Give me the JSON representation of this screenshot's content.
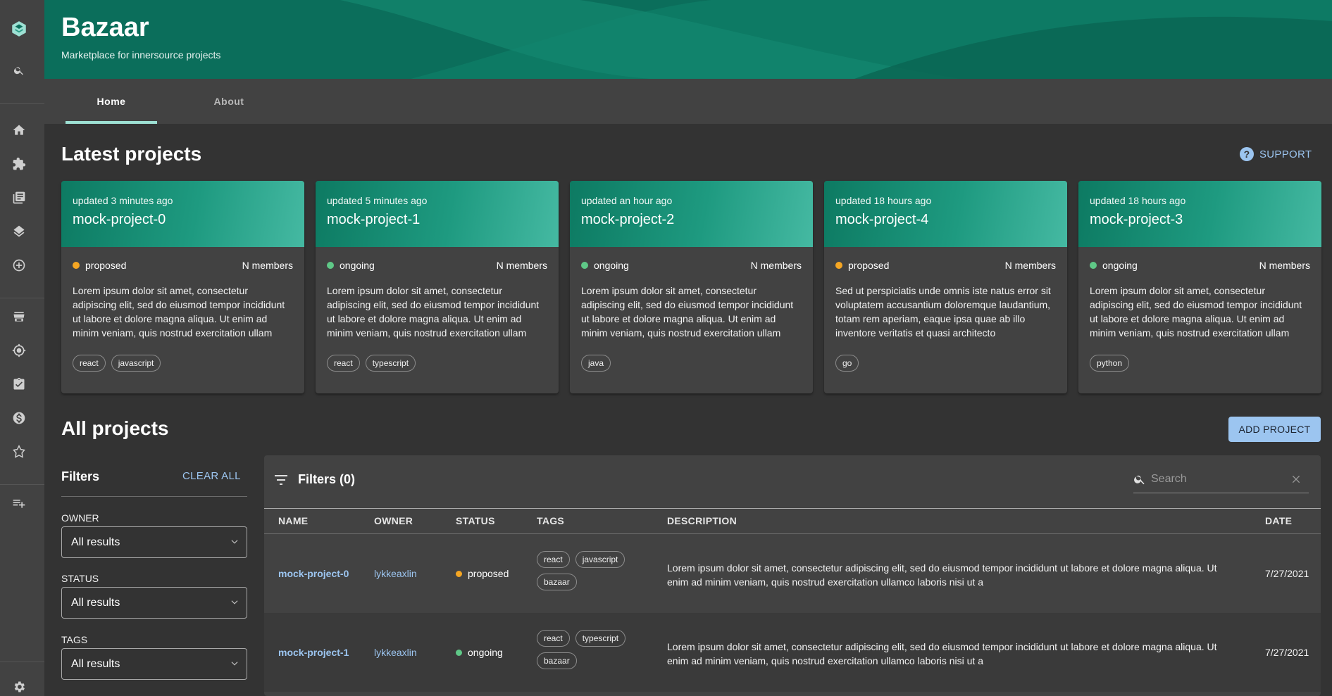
{
  "header": {
    "title": "Bazaar",
    "subtitle": "Marketplace for innersource projects"
  },
  "tabs": [
    {
      "label": "Home",
      "active": true
    },
    {
      "label": "About",
      "active": false
    }
  ],
  "sidebar": {
    "icons": [
      "logo-icon",
      "search-icon",
      "home-icon",
      "puzzle-icon",
      "library-icon",
      "layers-icon",
      "add-circle-icon",
      "storefront-icon",
      "radar-icon",
      "checklist-icon",
      "cost-icon",
      "graph-icon",
      "playlist-add-icon",
      "settings-icon"
    ]
  },
  "latest": {
    "heading": "Latest projects",
    "support_label": "SUPPORT",
    "cards": [
      {
        "updated": "updated 3 minutes ago",
        "name": "mock-project-0",
        "status": "proposed",
        "members": "N members",
        "description": "Lorem ipsum dolor sit amet, consectetur adipiscing elit, sed do eiusmod tempor incididunt ut labore et dolore magna aliqua. Ut enim ad minim veniam, quis nostrud exercitation ullam",
        "tags": [
          "react",
          "javascript"
        ]
      },
      {
        "updated": "updated 5 minutes ago",
        "name": "mock-project-1",
        "status": "ongoing",
        "members": "N members",
        "description": "Lorem ipsum dolor sit amet, consectetur adipiscing elit, sed do eiusmod tempor incididunt ut labore et dolore magna aliqua. Ut enim ad minim veniam, quis nostrud exercitation ullam",
        "tags": [
          "react",
          "typescript"
        ]
      },
      {
        "updated": "updated an hour ago",
        "name": "mock-project-2",
        "status": "ongoing",
        "members": "N members",
        "description": "Lorem ipsum dolor sit amet, consectetur adipiscing elit, sed do eiusmod tempor incididunt ut labore et dolore magna aliqua. Ut enim ad minim veniam, quis nostrud exercitation ullam",
        "tags": [
          "java"
        ]
      },
      {
        "updated": "updated 18 hours ago",
        "name": "mock-project-4",
        "status": "proposed",
        "members": "N members",
        "description": "Sed ut perspiciatis unde omnis iste natus error sit voluptatem accusantium doloremque laudantium, totam rem aperiam, eaque ipsa quae ab illo inventore veritatis et quasi architecto",
        "tags": [
          "go"
        ]
      },
      {
        "updated": "updated 18 hours ago",
        "name": "mock-project-3",
        "status": "ongoing",
        "members": "N members",
        "description": "Lorem ipsum dolor sit amet, consectetur adipiscing elit, sed do eiusmod tempor incididunt ut labore et dolore magna aliqua. Ut enim ad minim veniam, quis nostrud exercitation ullam",
        "tags": [
          "python"
        ]
      }
    ]
  },
  "all": {
    "heading": "All projects",
    "add_label": "ADD PROJECT",
    "filters": {
      "title": "Filters",
      "clear_label": "CLEAR ALL",
      "owner_label": "OWNER",
      "owner_value": "All results",
      "status_label": "STATUS",
      "status_value": "All results",
      "tags_label": "TAGS",
      "tags_value": "All results"
    },
    "table": {
      "filters_label": "Filters (0)",
      "search_placeholder": "Search",
      "columns": [
        "NAME",
        "OWNER",
        "STATUS",
        "TAGS",
        "DESCRIPTION",
        "DATE"
      ],
      "rows": [
        {
          "name": "mock-project-0",
          "owner": "lykkeaxlin",
          "status": "proposed",
          "tags": [
            "react",
            "javascript",
            "bazaar"
          ],
          "description": "Lorem ipsum dolor sit amet, consectetur adipiscing elit, sed do eiusmod tempor incididunt ut labore et dolore magna aliqua. Ut enim ad minim veniam, quis nostrud exercitation ullamco laboris nisi ut a",
          "date": "7/27/2021"
        },
        {
          "name": "mock-project-1",
          "owner": "lykkeaxlin",
          "status": "ongoing",
          "tags": [
            "react",
            "typescript",
            "bazaar"
          ],
          "description": "Lorem ipsum dolor sit amet, consectetur adipiscing elit, sed do eiusmod tempor incididunt ut labore et dolore magna aliqua. Ut enim ad minim veniam, quis nostrud exercitation ullamco laboris nisi ut a",
          "date": "7/27/2021"
        }
      ]
    }
  },
  "colors": {
    "proposed": "#f5a623",
    "ongoing": "#5fc887",
    "accent": "#9cc5f0",
    "header": "#0b6e5b"
  }
}
